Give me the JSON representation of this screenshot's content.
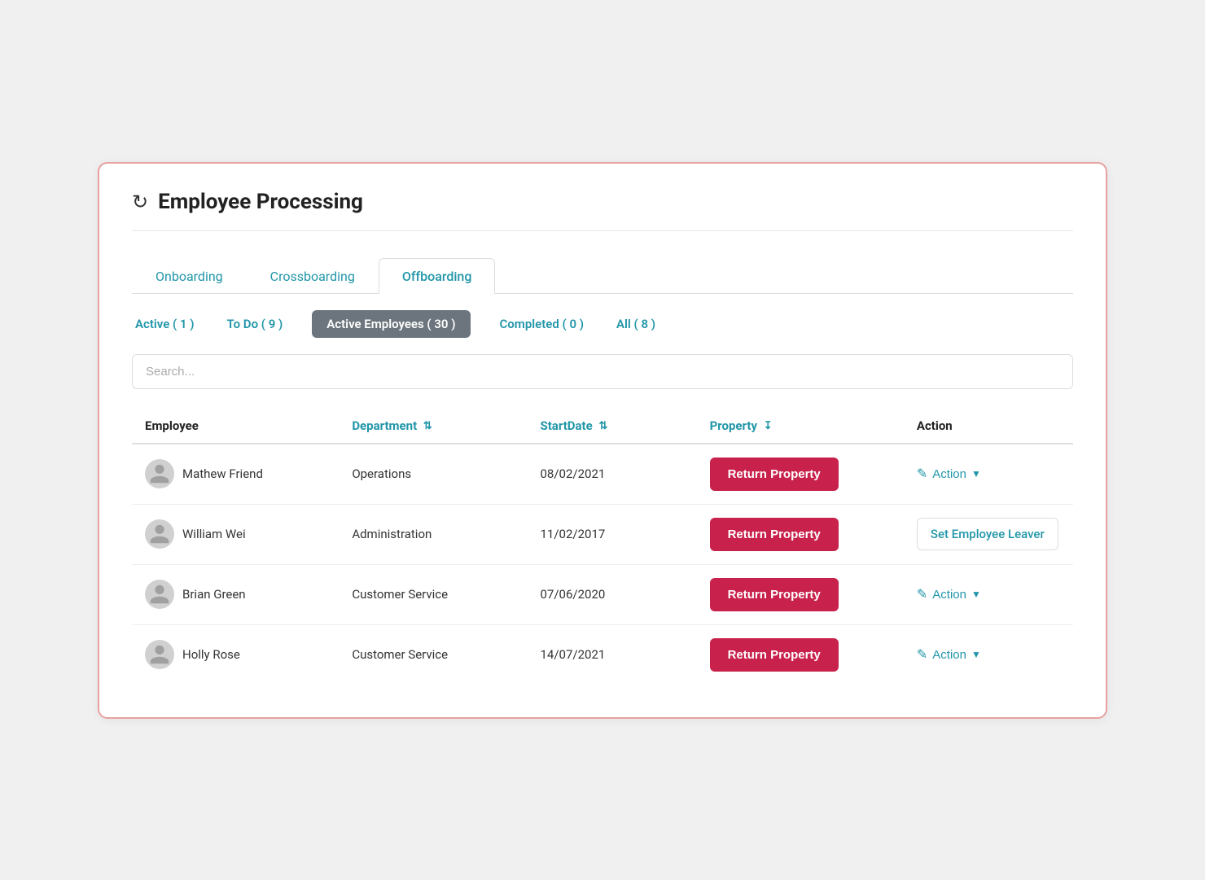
{
  "page": {
    "title": "Employee Processing",
    "refresh_icon": "↻"
  },
  "tabs": [
    {
      "id": "onboarding",
      "label": "Onboarding",
      "active": false
    },
    {
      "id": "crossboarding",
      "label": "Crossboarding",
      "active": false
    },
    {
      "id": "offboarding",
      "label": "Offboarding",
      "active": true
    }
  ],
  "sub_tabs": [
    {
      "id": "active",
      "label": "Active ( 1 )",
      "active": false
    },
    {
      "id": "todo",
      "label": "To Do ( 9 )",
      "active": false
    },
    {
      "id": "active_employees",
      "label": "Active Employees ( 30 )",
      "active": true
    },
    {
      "id": "completed",
      "label": "Completed ( 0 )",
      "active": false
    },
    {
      "id": "all",
      "label": "All ( 8 )",
      "active": false
    }
  ],
  "search": {
    "placeholder": "Search..."
  },
  "table": {
    "columns": [
      {
        "id": "employee",
        "label": "Employee",
        "sortable": false
      },
      {
        "id": "department",
        "label": "Department",
        "sortable": true
      },
      {
        "id": "startdate",
        "label": "StartDate",
        "sortable": true
      },
      {
        "id": "property",
        "label": "Property",
        "sortable": true
      },
      {
        "id": "action",
        "label": "Action",
        "sortable": false
      }
    ],
    "rows": [
      {
        "id": 1,
        "employee": "Mathew Friend",
        "department": "Operations",
        "startdate": "08/02/2021",
        "property_label": "Return Property",
        "action_type": "dropdown",
        "action_label": "Action"
      },
      {
        "id": 2,
        "employee": "William Wei",
        "department": "Administration",
        "startdate": "11/02/2017",
        "property_label": "Return Property",
        "action_type": "link",
        "action_label": "Set Employee Leaver"
      },
      {
        "id": 3,
        "employee": "Brian Green",
        "department": "Customer Service",
        "startdate": "07/06/2020",
        "property_label": "Return Property",
        "action_type": "dropdown",
        "action_label": "Action"
      },
      {
        "id": 4,
        "employee": "Holly Rose",
        "department": "Customer Service",
        "startdate": "14/07/2021",
        "property_label": "Return Property",
        "action_type": "dropdown",
        "action_label": "Action"
      }
    ]
  }
}
